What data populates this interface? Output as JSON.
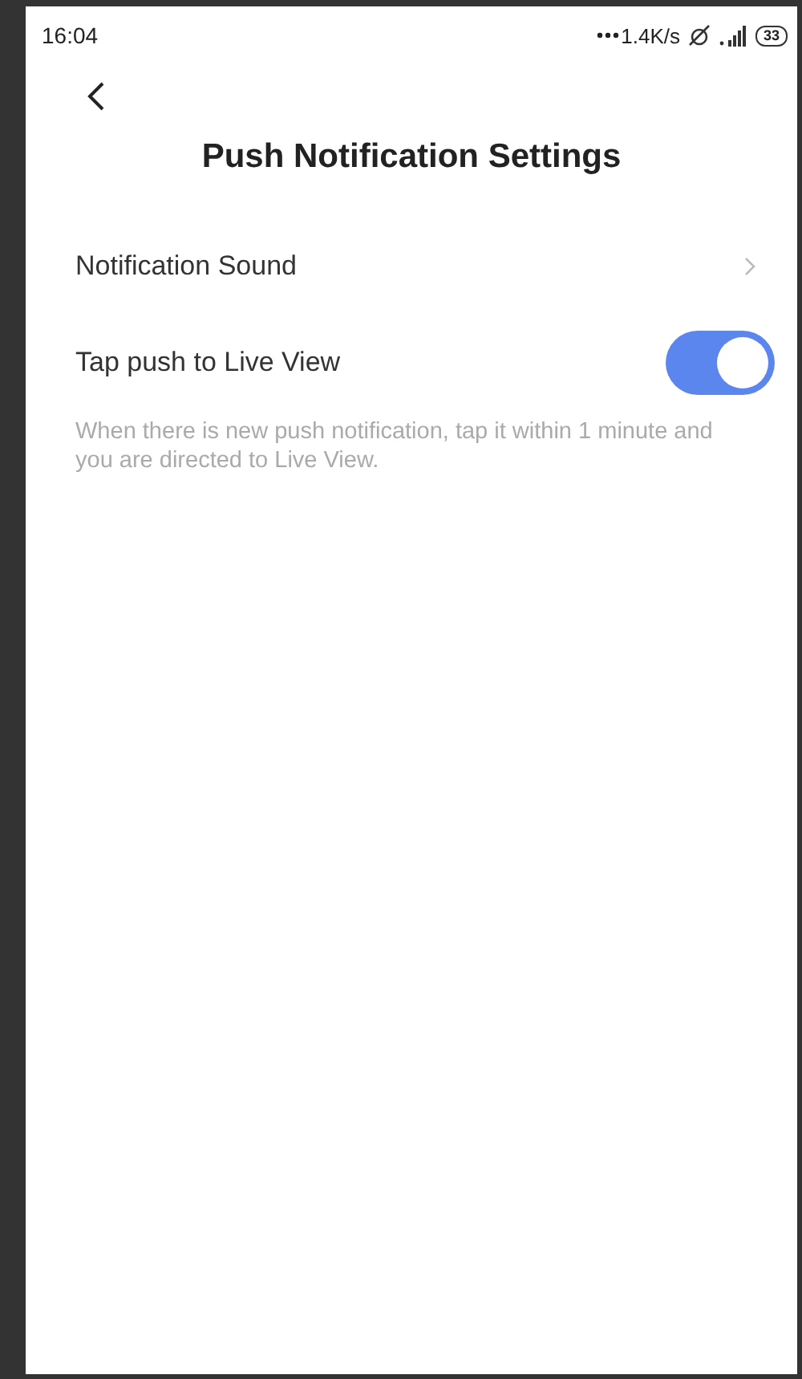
{
  "status_bar": {
    "time": "16:04",
    "speed": "1.4K/s",
    "battery": "33"
  },
  "header": {
    "title": "Push Notification Settings"
  },
  "settings": [
    {
      "kind": "link",
      "label": "Notification Sound"
    },
    {
      "kind": "toggle",
      "label": "Tap push to Live View",
      "on": true,
      "description": "When there is new push notification, tap it within 1 minute and you are directed to Live View."
    }
  ]
}
